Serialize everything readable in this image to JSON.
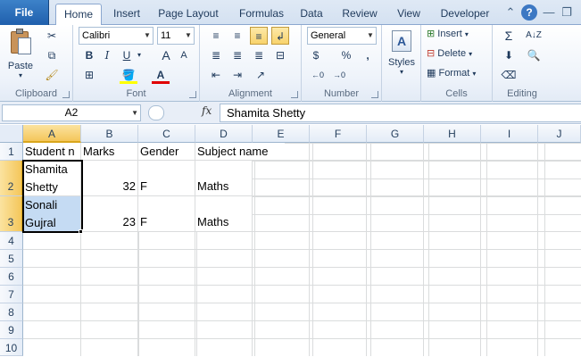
{
  "tabs": {
    "file": "File",
    "home": "Home",
    "insert": "Insert",
    "page_layout": "Page Layout",
    "formulas": "Formulas",
    "data": "Data",
    "review": "Review",
    "view": "View",
    "developer": "Developer"
  },
  "ribbon": {
    "clipboard": {
      "label": "Clipboard",
      "paste": "Paste"
    },
    "font": {
      "label": "Font",
      "font_name": "Calibri",
      "font_size": "11"
    },
    "alignment": {
      "label": "Alignment"
    },
    "number": {
      "label": "Number",
      "format": "General"
    },
    "styles": {
      "label": "Styles"
    },
    "cells": {
      "label": "Cells",
      "insert": "Insert",
      "delete": "Delete",
      "format": "Format"
    },
    "editing": {
      "label": "Editing"
    }
  },
  "formula_bar": {
    "name_box": "A2",
    "fx": "fx",
    "content": "Shamita Shetty"
  },
  "columns": [
    "A",
    "B",
    "C",
    "D",
    "E",
    "F",
    "G",
    "H",
    "I",
    "J"
  ],
  "rows": [
    "1",
    "2",
    "3",
    "4",
    "5",
    "6",
    "7",
    "8",
    "9",
    "10"
  ],
  "cells": {
    "A1": "Student n",
    "B1": "Marks",
    "C1": "Gender",
    "D1": "Subject name",
    "A2_line1": "Shamita",
    "A2_line2": "Shetty",
    "B2": "32",
    "C2": "F",
    "D2": "Maths",
    "A3_line1": "Sonali",
    "A3_line2": "Gujral",
    "B3": "23",
    "C3": "F",
    "D3": "Maths"
  }
}
